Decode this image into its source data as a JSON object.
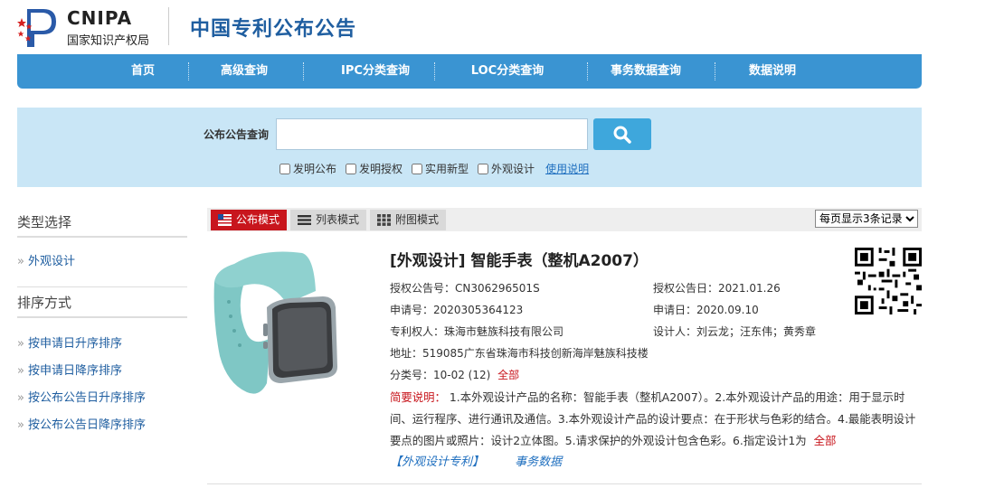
{
  "header": {
    "logo_text": "CNIPA",
    "logo_sub": "国家知识产权局",
    "site_title": "中国专利公布公告"
  },
  "nav": {
    "items": [
      "首页",
      "高级查询",
      "IPC分类查询",
      "LOC分类查询",
      "事务数据查询",
      "数据说明"
    ]
  },
  "search": {
    "label": "公布公告查询",
    "value": "",
    "filters": [
      "发明公布",
      "发明授权",
      "实用新型",
      "外观设计"
    ],
    "help": "使用说明"
  },
  "sidebar": {
    "type_heading": "类型选择",
    "type_items": [
      "外观设计"
    ],
    "sort_heading": "排序方式",
    "sort_items": [
      "按申请日升序排序",
      "按申请日降序排序",
      "按公布公告日升序排序",
      "按公布公告日降序排序"
    ]
  },
  "toolbar": {
    "modes": [
      "公布模式",
      "列表模式",
      "附图模式"
    ],
    "per_page": "每页显示3条记录"
  },
  "result": {
    "title": "[外观设计] 智能手表（整机A2007）",
    "pub_no": "授权公告号：CN306296501S",
    "pub_date": "授权公告日：2021.01.26",
    "app_no": "申请号：2020305364123",
    "app_date": "申请日：2020.09.10",
    "patentee": "专利权人：珠海市魅族科技有限公司",
    "designer": "设计人：刘云龙；汪东伟；黄秀章",
    "address": "地址：519085广东省珠海市科技创新海岸魅族科技楼",
    "class_no": "分类号：10-02 (12)",
    "class_all": "全部",
    "abstract_label": "简要说明：",
    "abstract": "1.本外观设计产品的名称：智能手表（整机A2007）。2.本外观设计产品的用途：用于显示时间、运行程序、进行通讯及通信。3.本外观设计产品的设计要点：在于形状与色彩的结合。4.最能表明设计要点的图片或照片：设计2立体图。5.请求保护的外观设计包含色彩。6.指定设计1为",
    "abstract_all": "全部",
    "link1": "【外观设计专利】",
    "link2": "事务数据"
  },
  "colors": {
    "nav_bg": "#3a94d2",
    "search_bg": "#c9e6f6",
    "accent_red": "#c8161d",
    "title_blue": "#1f5ea0",
    "watch_band": "#8fd1cf"
  }
}
